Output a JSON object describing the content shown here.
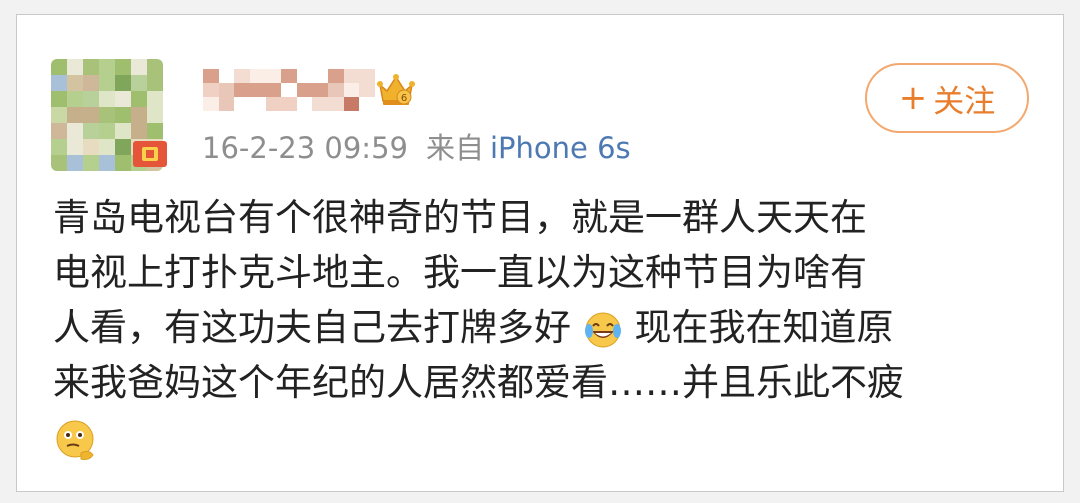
{
  "post": {
    "timestamp": "16-2-23 09:59",
    "source_prefix": "来自",
    "device": "iPhone 6s",
    "follow_button": {
      "plus": "+",
      "label": "关注"
    },
    "lines": {
      "l1": "青岛电视台有个很神奇的节目，就是一群人天天在",
      "l2": "电视上打扑克斗地主。我一直以为这种节目为啥有",
      "l3a": "人看，有这功夫自己去打牌多好",
      "l3b": "现在我在知道原",
      "l4": "来我爸妈这个年纪的人居然都爱看……并且乐此不疲"
    },
    "icons": [
      "laughing-tears-emoji",
      "thinking-emoji",
      "crown-badge-icon",
      "verified-badge-icon"
    ]
  },
  "colors": {
    "accent": "#e87d2c",
    "meta_text": "#8e8e8e",
    "link_blue": "#4d79b3",
    "body_text": "#222222"
  }
}
